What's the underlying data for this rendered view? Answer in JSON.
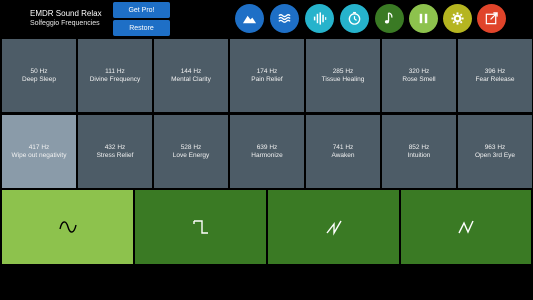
{
  "header": {
    "app_title": "EMDR Sound Relax",
    "app_subtitle": "Solfeggio Frequencies",
    "get_pro_label": "Get Pro!",
    "restore_label": "Restore"
  },
  "toolbar_icons": [
    {
      "name": "landscape-icon",
      "color": "#1e6fc6"
    },
    {
      "name": "waves-icon",
      "color": "#1e6fc6"
    },
    {
      "name": "sound-bars-icon",
      "color": "#26b3cc"
    },
    {
      "name": "timer-icon",
      "color": "#26b3cc"
    },
    {
      "name": "music-note-icon",
      "color": "#3a7a24"
    },
    {
      "name": "pause-icon",
      "color": "#8dc24d"
    },
    {
      "name": "gear-icon",
      "color": "#b5b520"
    },
    {
      "name": "external-link-icon",
      "color": "#e0442a"
    }
  ],
  "frequencies": [
    {
      "hz": "50 Hz",
      "name": "Deep Sleep"
    },
    {
      "hz": "111 Hz",
      "name": "Divine Frequency"
    },
    {
      "hz": "144 Hz",
      "name": "Mental Clarity"
    },
    {
      "hz": "174 Hz",
      "name": "Pain Relief"
    },
    {
      "hz": "285 Hz",
      "name": "Tissue Healing"
    },
    {
      "hz": "320 Hz",
      "name": "Rose Smell"
    },
    {
      "hz": "396 Hz",
      "name": "Fear Release"
    },
    {
      "hz": "417 Hz",
      "name": "Wipe out negativity"
    },
    {
      "hz": "432 Hz",
      "name": "Stress Relief"
    },
    {
      "hz": "528 Hz",
      "name": "Love Energy"
    },
    {
      "hz": "639 Hz",
      "name": "Harmonize"
    },
    {
      "hz": "741 Hz",
      "name": "Awaken"
    },
    {
      "hz": "852 Hz",
      "name": "Intuition"
    },
    {
      "hz": "963 Hz",
      "name": "Open 3rd Eye"
    }
  ],
  "selected_frequency": "417 Hz",
  "waveforms": [
    {
      "name": "sine-wave-icon",
      "selected": true
    },
    {
      "name": "square-wave-icon",
      "selected": false
    },
    {
      "name": "sawtooth-wave-icon",
      "selected": false
    },
    {
      "name": "triangle-wave-icon",
      "selected": false
    }
  ],
  "colors": {
    "cell": "#4d5c67",
    "cell_selected": "#8a9ba9",
    "wave": "#3a7a24",
    "wave_selected": "#8dc24d",
    "accent_blue": "#1e6fc6"
  }
}
